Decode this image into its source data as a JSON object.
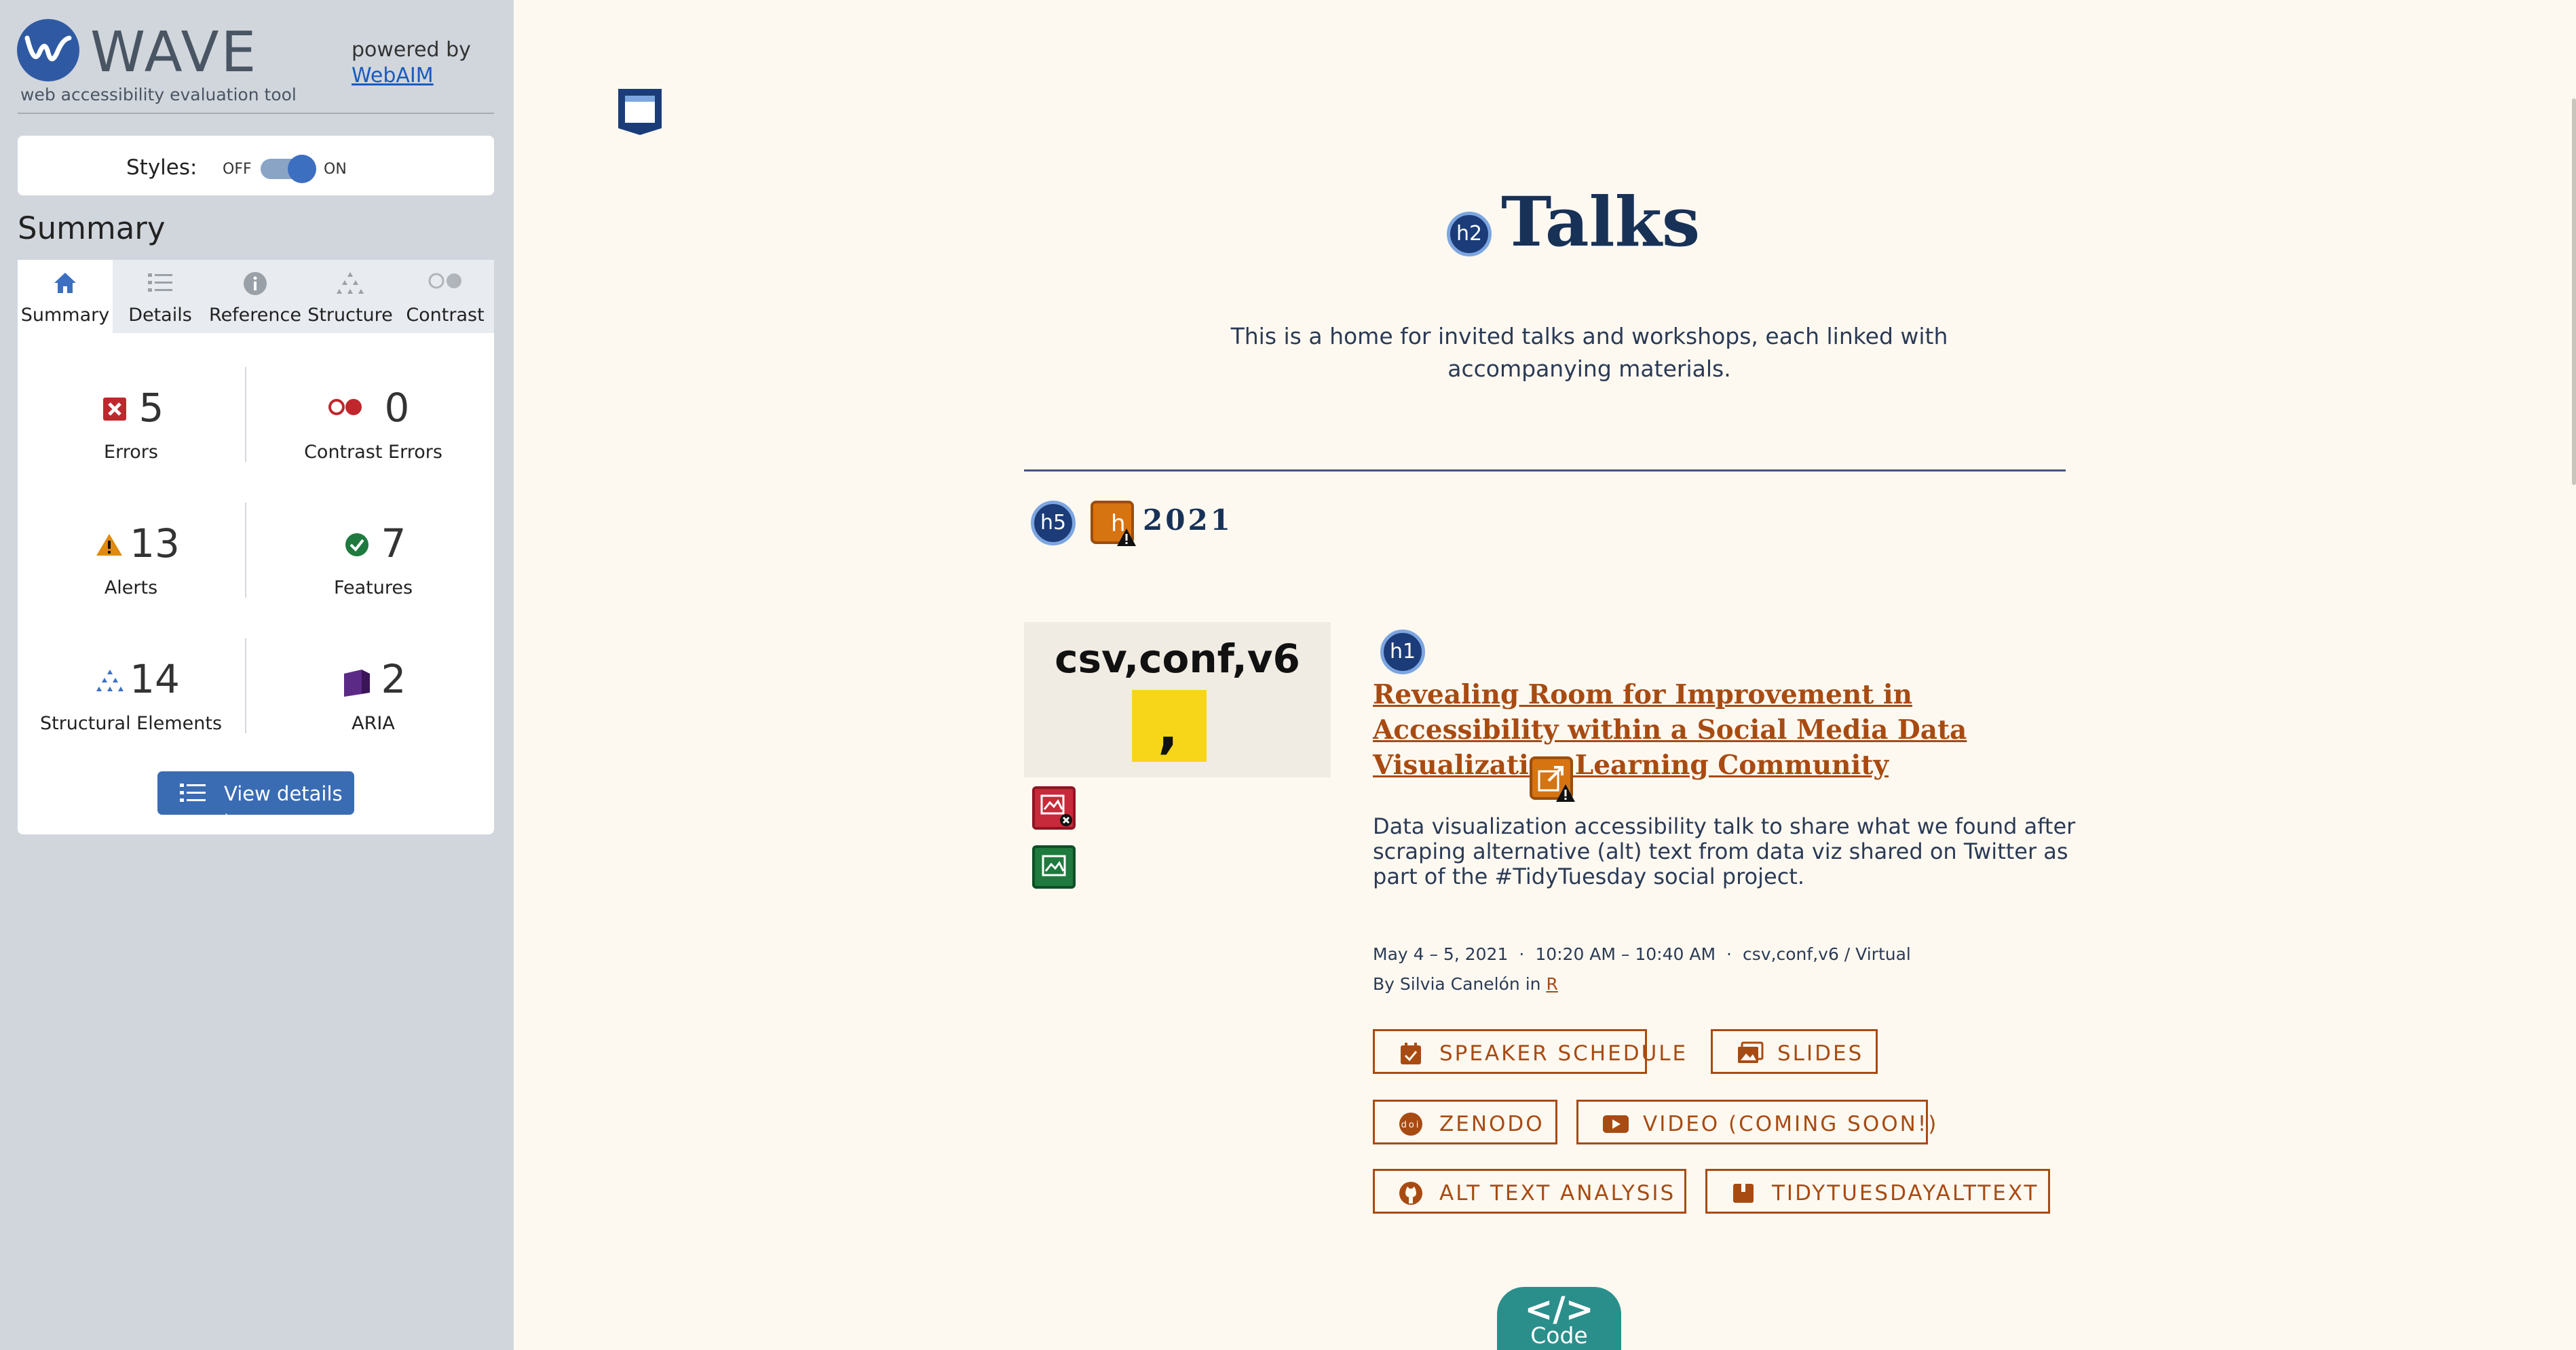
{
  "wave": {
    "logo_text": "WAVE",
    "logo_sub": "web accessibility evaluation tool",
    "powered_by": "powered by",
    "webaim": "WebAIM",
    "styles_label": "Styles:",
    "toggle_off": "OFF",
    "toggle_on": "ON",
    "summary_title": "Summary",
    "tabs": [
      {
        "label": "Summary",
        "icon": "home-icon",
        "active": true
      },
      {
        "label": "Details",
        "icon": "list-icon",
        "active": false
      },
      {
        "label": "Reference",
        "icon": "info-icon",
        "active": false
      },
      {
        "label": "Structure",
        "icon": "hierarchy-icon",
        "active": false
      },
      {
        "label": "Contrast",
        "icon": "contrast-icon",
        "active": false
      }
    ],
    "stats": {
      "errors": {
        "value": "5",
        "label": "Errors",
        "color": "#c0272d"
      },
      "contrast": {
        "value": "0",
        "label": "Contrast Errors",
        "color": "#c0272d"
      },
      "alerts": {
        "value": "13",
        "label": "Alerts",
        "color": "#e08a0f"
      },
      "features": {
        "value": "7",
        "label": "Features",
        "color": "#1e7a3e"
      },
      "structural": {
        "value": "14",
        "label": "Structural Elements",
        "color": "#3c6fc0"
      },
      "aria": {
        "value": "2",
        "label": "ARIA",
        "color": "#5b2a86"
      }
    },
    "view_details": "View details ›"
  },
  "page": {
    "h2_badge": "h2",
    "title": "Talks",
    "intro": "This is a home for invited talks and workshops, each linked with accompanying materials.",
    "h5_badge": "h5",
    "alert_badge": "h",
    "year": "2021",
    "thumb_title": "csv,conf,v6",
    "thumb_mark": ",",
    "h1_badge": "h1",
    "talk_title": "Revealing Room for Improvement in Accessibility within a Social Media Data Visualization Learning Community",
    "talk_desc": "Data visualization accessibility talk to share what we found after scraping alternative (alt) text from data viz shared on Twitter as part of the #TidyTuesday social project.",
    "date": "May 4 – 5, 2021",
    "time": "10:20 AM – 10:40 AM",
    "venue": "csv,conf,v6 / Virtual",
    "by_prefix": "By Silvia Canelón in",
    "by_link": "R",
    "buttons": [
      {
        "label": "SPEAKER SCHEDULE",
        "icon": "calendar-check-icon"
      },
      {
        "label": "SLIDES",
        "icon": "images-icon"
      },
      {
        "label": "ZENODO",
        "icon": "doi-icon"
      },
      {
        "label": "VIDEO (COMING SOON!)",
        "icon": "youtube-icon"
      },
      {
        "label": "ALT TEXT ANALYSIS",
        "icon": "github-icon"
      },
      {
        "label": "TIDYTUESDAYALTTEXT",
        "icon": "package-icon"
      }
    ],
    "code_symbol": "</>",
    "code_label": "Code"
  }
}
